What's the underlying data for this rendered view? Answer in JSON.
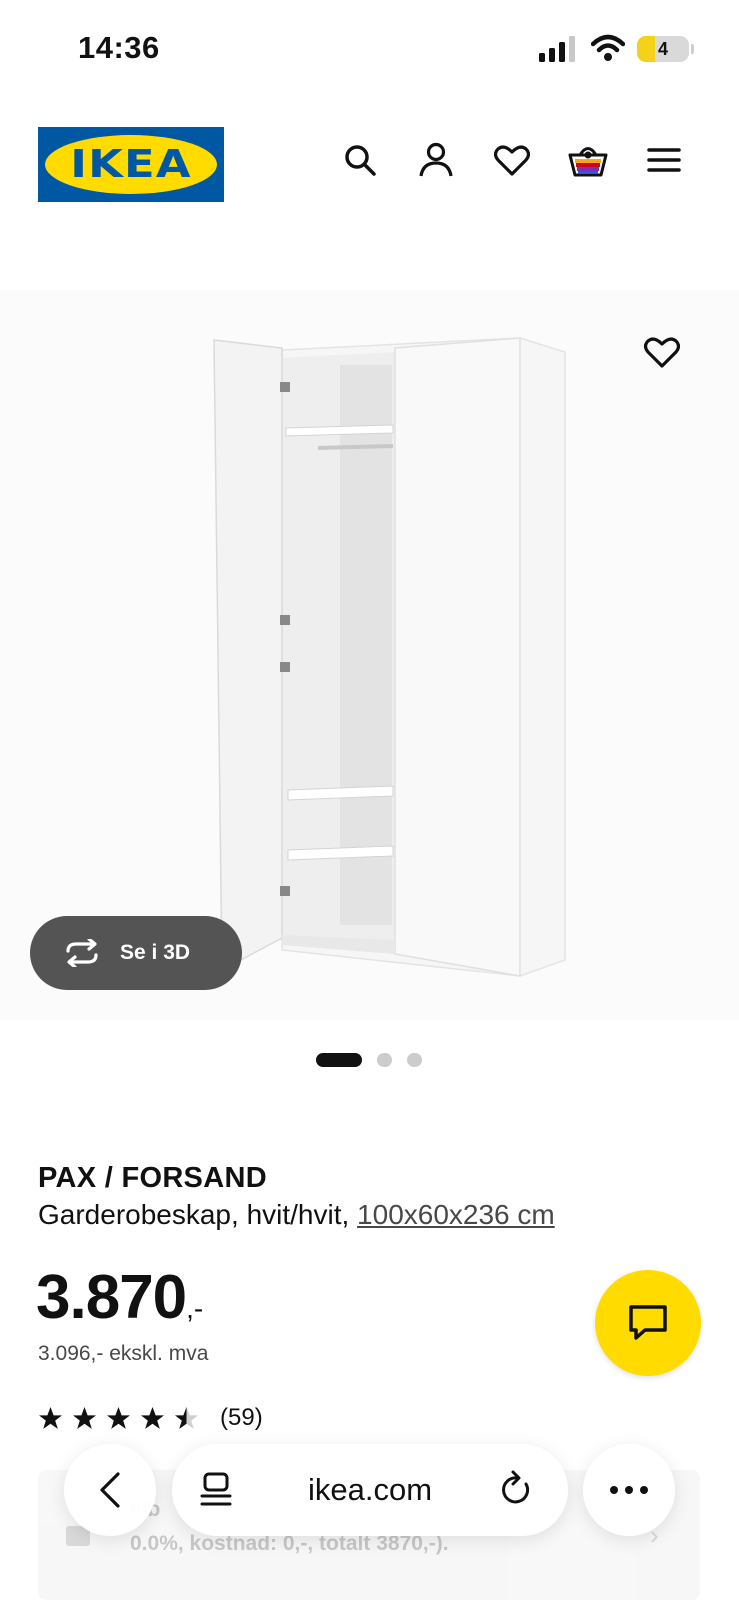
{
  "status_bar": {
    "time": "14:36",
    "battery_level": "4"
  },
  "header": {
    "logo_text": "IKEA",
    "icons": [
      "search-icon",
      "user-icon",
      "heart-icon",
      "basket-icon",
      "menu-icon"
    ]
  },
  "gallery": {
    "view_3d_label": "Se i 3D",
    "image_count": 3,
    "active_image": 1
  },
  "product": {
    "name": "PAX / FORSAND",
    "description": "Garderobeskap, hvit/hvit, ",
    "dimensions": "100x60x236 cm",
    "price": "3.870",
    "price_suffix": ",-",
    "price_ex_vat": "3.096,- ekskl. mva",
    "rating_stars": 4.5,
    "rating_count": "(59)"
  },
  "finance_banner": {
    "line1": "elb",
    "line2": "0.0%, kostnad: 0,-, totalt 3870,-)."
  },
  "browser": {
    "url": "ikea.com"
  },
  "colors": {
    "ikea_blue": "#0058a3",
    "ikea_yellow": "#ffdb00",
    "dark_button": "#545454"
  }
}
